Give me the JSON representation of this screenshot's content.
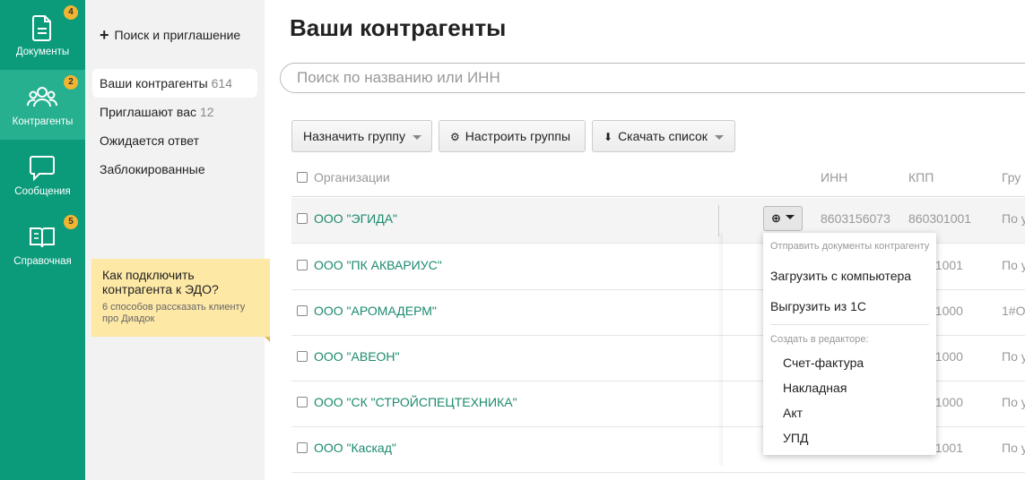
{
  "rail": {
    "items": [
      {
        "label": "Документы",
        "badge": "4",
        "icon": "document-icon"
      },
      {
        "label": "Контрагенты",
        "badge": "2",
        "icon": "people-icon",
        "active": true
      },
      {
        "label": "Сообщения",
        "badge": "",
        "icon": "chat-bubble-icon"
      },
      {
        "label": "Справочная",
        "badge": "5",
        "icon": "book-icon"
      }
    ]
  },
  "subnav": {
    "search_invite": "Поиск и приглашение",
    "items": [
      {
        "label": "Ваши контрагенты",
        "count": "614"
      },
      {
        "label": "Приглашают вас",
        "count": "12"
      },
      {
        "label": "Ожидается ответ",
        "count": ""
      },
      {
        "label": "Заблокированные",
        "count": ""
      }
    ],
    "promo": {
      "title": "Как подключить контрагента к ЭДО?",
      "subtitle": "6 способов рассказать клиенту про Диадок"
    }
  },
  "main": {
    "title": "Ваши контрагенты",
    "search_placeholder": "Поиск по названию или ИНН",
    "toolbar": {
      "assign_group": "Назначить группу",
      "configure_groups": "Настроить группы",
      "download_list": "Скачать список"
    },
    "columns": {
      "org": "Организации",
      "inn": "ИНН",
      "kpp": "КПП",
      "group": "Гру"
    },
    "rows": [
      {
        "name": "ООО \"ЭГИДА\"",
        "inn": "8603156073",
        "kpp": "860301001",
        "group": "По у"
      },
      {
        "name": "ООО \"ПК АКВАРИУС\"",
        "inn": "",
        "kpp": "01001",
        "group": "По у"
      },
      {
        "name": "ООО \"АРОМАДЕРМ\"",
        "inn": "",
        "kpp": "01000",
        "group": "1#О"
      },
      {
        "name": "ООО \"АВЕОН\"",
        "inn": "",
        "kpp": "01000",
        "group": "По у"
      },
      {
        "name": "ООО \"СК \"СТРОЙСПЕЦТЕХНИКА\"",
        "inn": "",
        "kpp": "01000",
        "group": "По у"
      },
      {
        "name": "ООО \"Каскад\"",
        "inn": "",
        "kpp": "01001",
        "group": "По у"
      }
    ]
  },
  "dropdown": {
    "send_header": "Отправить документы контрагенту",
    "upload_pc": "Загрузить с компьютера",
    "export_1c": "Выгрузить из 1С",
    "create_header": "Создать в редакторе:",
    "invoice": "Счет-фактура",
    "waybill": "Накладная",
    "act": "Акт",
    "upd": "УПД"
  },
  "colors": {
    "rail_bg": "#0b9b7b",
    "rail_active": "#27b08f",
    "badge": "#f2b531",
    "link": "#1b8a6e",
    "promo_bg": "#fde8a6"
  }
}
